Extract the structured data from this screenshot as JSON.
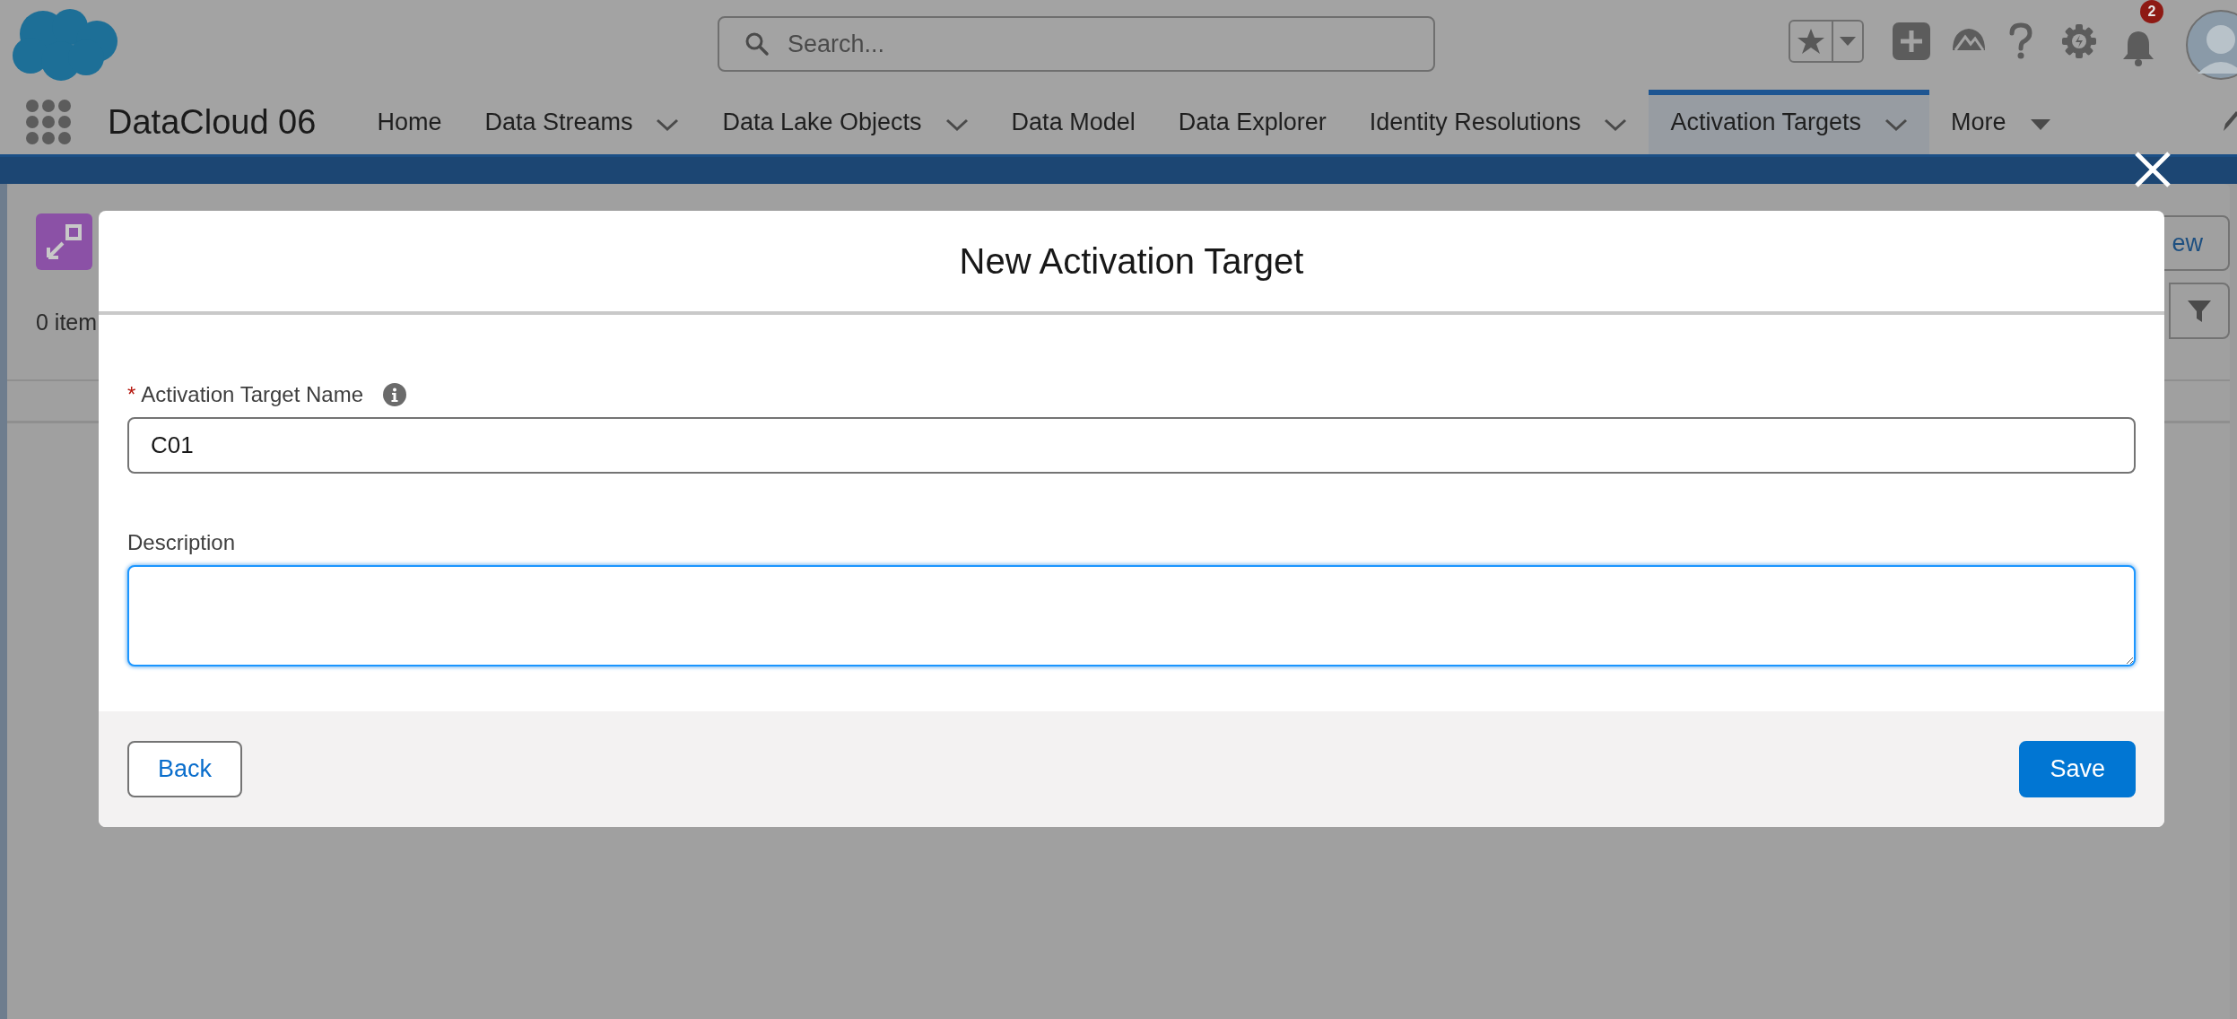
{
  "app": {
    "name": "DataCloud 06"
  },
  "search": {
    "placeholder": "Search..."
  },
  "notifications": {
    "count": "2"
  },
  "nav_items": [
    {
      "label": "Home",
      "kind": "link",
      "selected": false
    },
    {
      "label": "Data Streams",
      "kind": "chevron-menu",
      "selected": false
    },
    {
      "label": "Data Lake Objects",
      "kind": "chevron-menu",
      "selected": false
    },
    {
      "label": "Data Model",
      "kind": "link",
      "selected": false
    },
    {
      "label": "Data Explorer",
      "kind": "link",
      "selected": false
    },
    {
      "label": "Identity Resolutions",
      "kind": "chevron-menu",
      "selected": false
    },
    {
      "label": "Activation Targets",
      "kind": "chevron-menu",
      "selected": true
    },
    {
      "label": "More",
      "kind": "triangle-menu",
      "selected": false
    }
  ],
  "background_page": {
    "item_count": "0 item",
    "new_button": "ew"
  },
  "modal": {
    "title": "New Activation Target",
    "fields": [
      {
        "kind": "input",
        "required_mark": "*",
        "label": "Activation Target Name",
        "info": true,
        "value": "C01",
        "focused": false
      },
      {
        "kind": "textarea",
        "label": "Description",
        "focused": true
      }
    ],
    "buttons": [
      {
        "label": "Back",
        "kind": "neutral"
      },
      {
        "label": "Save",
        "kind": "brand"
      }
    ]
  }
}
